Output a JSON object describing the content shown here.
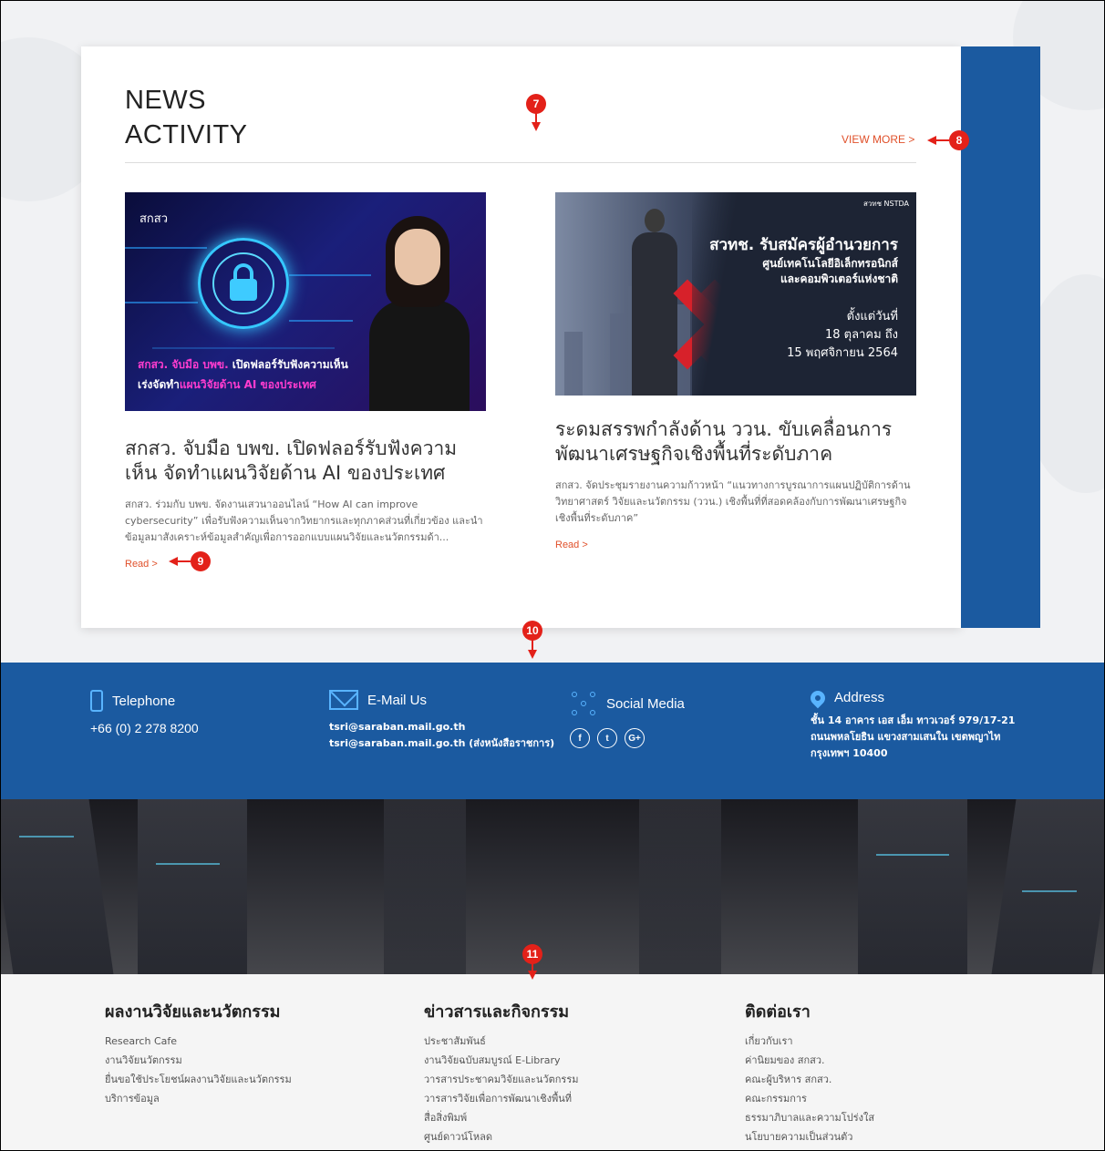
{
  "news": {
    "title_line1": "NEWS",
    "title_line2": "ACTIVITY",
    "view_more": "VIEW MORE >",
    "articles": [
      {
        "image_logo": "สกสว",
        "image_caption_pink": "สกสว. จับมือ บพข.",
        "image_caption_rest1": " เปิดฟลอร์รับฟังความเห็น",
        "image_caption_line2_a": "เร่งจัดทำ",
        "image_caption_line2_pink": "แผนวิจัยด้าน AI ของประเทศ",
        "title": "สกสว. จับมือ บพข. เปิดฟลอร์รับฟังความเห็น จัดทำแผนวิจัยด้าน AI ของประเทศ",
        "desc": "สกสว. ร่วมกับ บพข. จัดงานเสวนาออนไลน์ “How AI can improve cybersecurity” เพื่อรับฟังความเห็นจากวิทยากรและทุกภาคส่วนที่เกี่ยวข้อง และนำข้อมูลมาสังเคราะห์ข้อมูลสำคัญเพื่อการออกแบบแผนวิจัยและนวัตกรรมด้า...",
        "read": "Read >"
      },
      {
        "image_logo": "สวทช NSTDA",
        "image_headline": "สวทช. รับสมัครผู้อำนวยการ",
        "image_sub1": "ศูนย์เทคโนโลยีอิเล็กทรอนิกส์",
        "image_sub2": "และคอมพิวเตอร์แห่งชาติ",
        "image_date1": "ตั้งแต่วันที่",
        "image_date2": "18 ตุลาคม ถึง",
        "image_date3": "15 พฤศจิกายน 2564",
        "title": "ระดมสรรพกำลังด้าน ววน. ขับเคลื่อนการพัฒนาเศรษฐกิจเชิงพื้นที่ระดับภาค",
        "desc": "สกสว. จัดประชุมรายงานความก้าวหน้า “แนวทางการบูรณาการแผนปฏิบัติการด้านวิทยาศาสตร์ วิจัยและนวัตกรรม (ววน.) เชิงพื้นที่ที่สอดคล้องกับการพัฒนาเศรษฐกิจเชิงพื้นที่ระดับภาค”",
        "read": "Read >"
      }
    ]
  },
  "annotations": {
    "m7": "7",
    "m8": "8",
    "m9": "9",
    "m10": "10",
    "m11": "11"
  },
  "contact": {
    "telephone_label": "Telephone",
    "telephone_value": "+66 (0) 2 278 8200",
    "email_label": "E-Mail Us",
    "email_line1": "tsri@saraban.mail.go.th",
    "email_line2": "tsri@saraban.mail.go.th (ส่งหนังสือราชการ)",
    "social_label": "Social Media",
    "social": [
      "f",
      "t",
      "G+"
    ],
    "address_label": "Address",
    "address_line1": "ชั้น 14 อาคาร เอส เอ็ม ทาวเวอร์ 979/17-21",
    "address_line2": "ถนนพหลโยธิน แขวงสามเสนใน เขตพญาไท",
    "address_line3": "กรุงเทพฯ 10400"
  },
  "footer": {
    "columns": [
      {
        "title": "ผลงานวิจัยและนวัตกรรม",
        "links": [
          "Research Cafe",
          "งานวิจัยนวัตกรรม",
          "ยื่นขอใช้ประโยชน์ผลงานวิจัยและนวัตกรรม",
          "บริการข้อมูล"
        ]
      },
      {
        "title": "ข่าวสารและกิจกรรม",
        "links": [
          "ประชาสัมพันธ์",
          "งานวิจัยฉบับสมบูรณ์ E-Library",
          "วารสารประชาคมวิจัยและนวัตกรรม",
          "วารสารวิจัยเพื่อการพัฒนาเชิงพื้นที่",
          "สื่อสิ่งพิมพ์",
          "ศูนย์ดาวน์โหลด"
        ]
      },
      {
        "title": "ติดต่อเรา",
        "links": [
          "เกี่ยวกับเรา",
          "ค่านิยมของ สกสว.",
          "คณะผู้บริหาร สกสว.",
          "คณะกรรมการ",
          "ธรรมาภิบาลและความโปร่งใส",
          "นโยบายความเป็นส่วนตัว"
        ]
      }
    ]
  },
  "colors": {
    "brand_blue": "#1b5aa0",
    "accent_orange": "#e0502a",
    "marker_red": "#e32119"
  }
}
